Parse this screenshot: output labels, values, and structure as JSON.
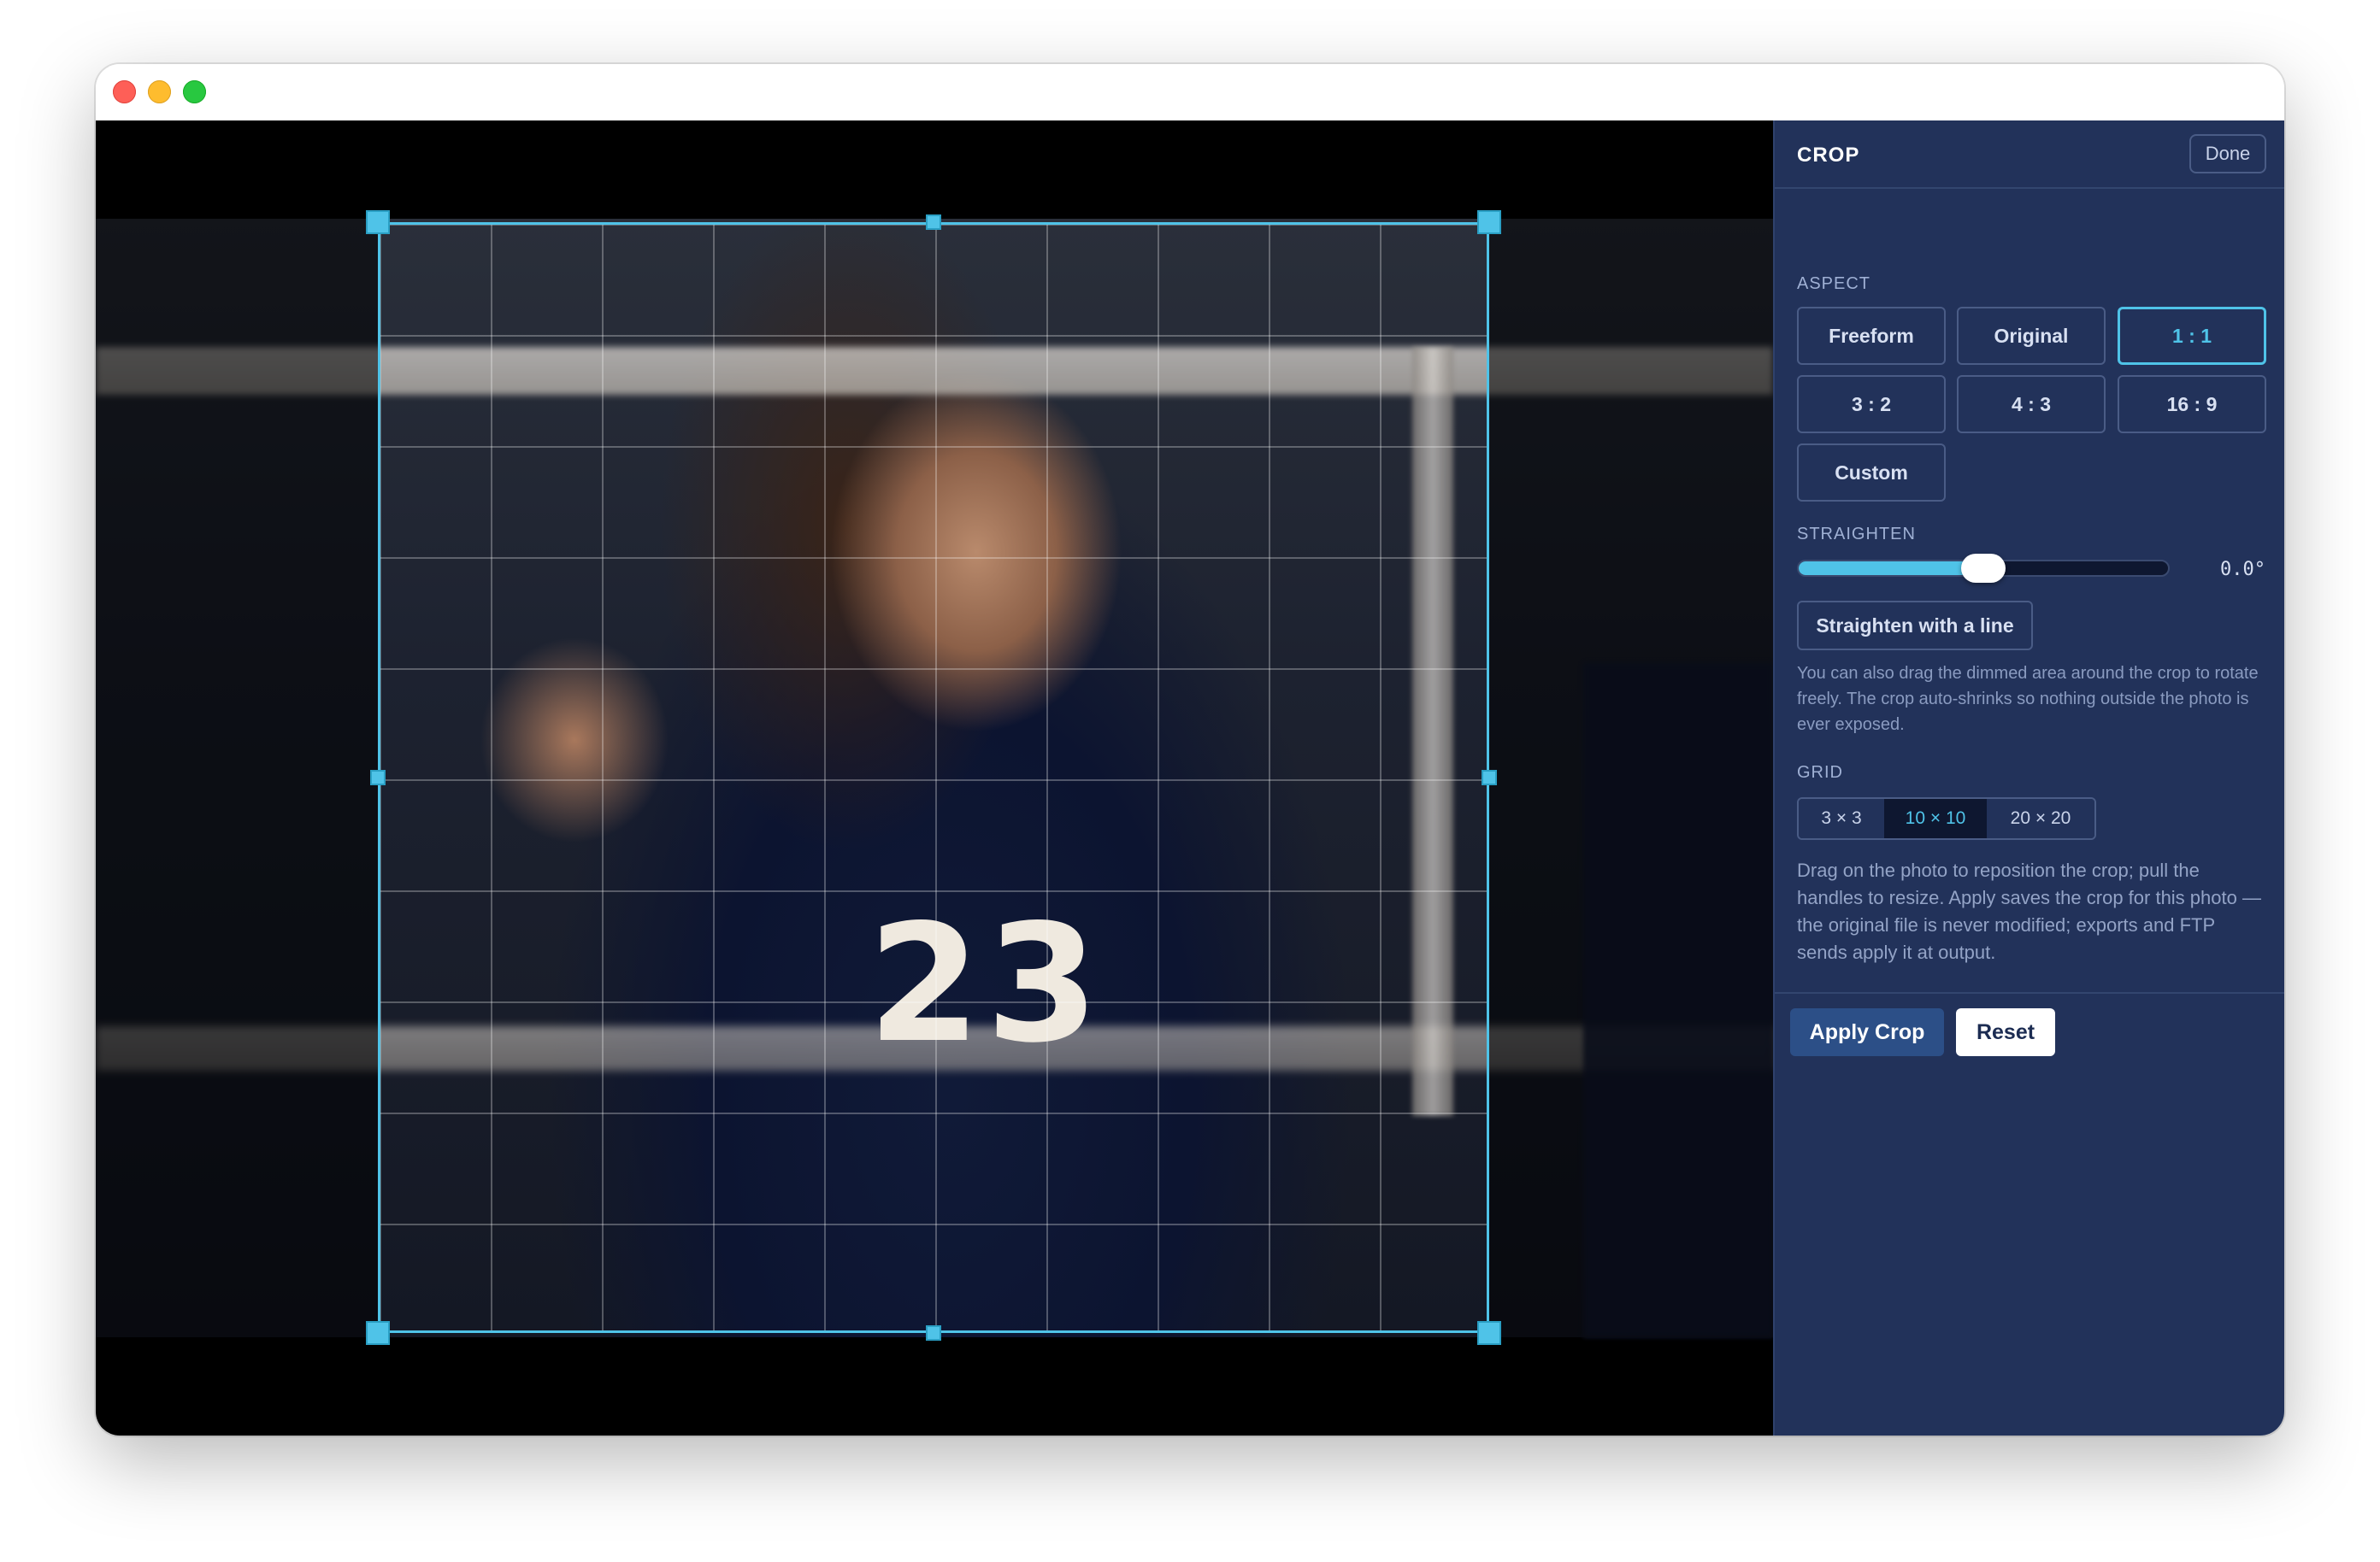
{
  "window": {
    "traffic_lights": [
      "close",
      "minimize",
      "zoom"
    ]
  },
  "photo": {
    "jersey_number": "23"
  },
  "panel": {
    "title": "CROP",
    "done_label": "Done",
    "aspect": {
      "label": "ASPECT",
      "options": [
        "Freeform",
        "Original",
        "1 : 1",
        "3 : 2",
        "4 : 3",
        "16 : 9",
        "Custom"
      ],
      "selected": "1 : 1"
    },
    "straighten": {
      "label": "STRAIGHTEN",
      "value_text": "0.0°",
      "slider_fraction": 0.5,
      "line_button": "Straighten with a line",
      "help": "You can also drag the dimmed area around the crop to rotate freely. The crop auto-shrinks so nothing outside the photo is ever exposed."
    },
    "grid": {
      "label": "GRID",
      "options": [
        "3 × 3",
        "10 × 10",
        "20 × 20"
      ],
      "selected": "10 × 10",
      "help": "Drag on the photo to reposition the crop; pull the handles to resize. Apply saves the crop for this photo — the original file is never modified; exports and FTP sends apply it at output."
    },
    "actions": {
      "apply_label": "Apply Crop",
      "reset_label": "Reset"
    }
  },
  "colors": {
    "accent": "#4fc3e8",
    "panel_bg": "#22325a",
    "apply_bg": "#2c4f87"
  }
}
